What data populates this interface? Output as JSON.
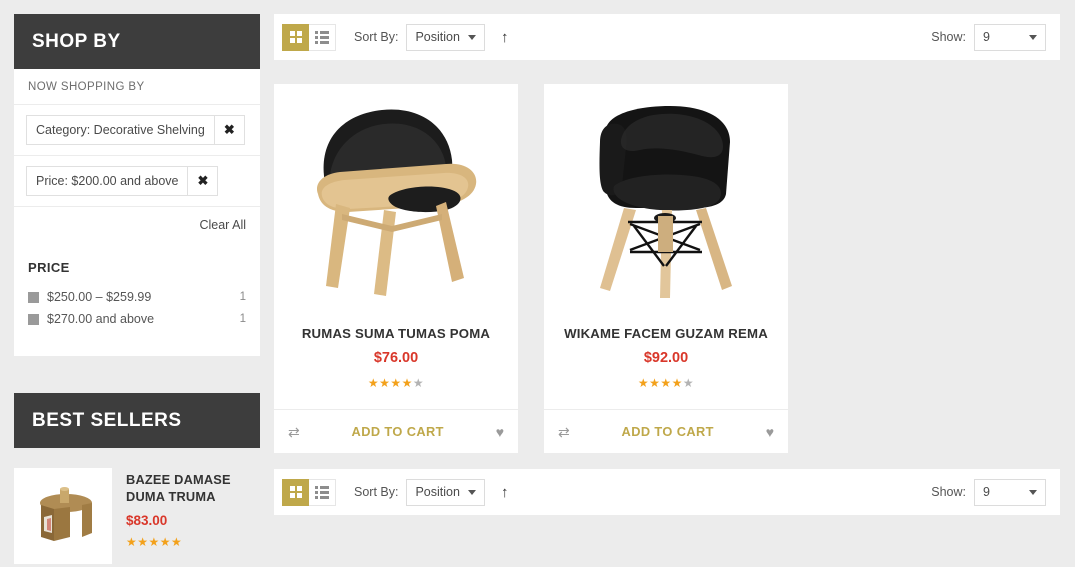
{
  "sidebar": {
    "shop_by_title": "SHOP BY",
    "now_shopping_by_label": "NOW SHOPPING BY",
    "active_filters": [
      {
        "label": "Category: Decorative Shelving",
        "remove_icon": "✖"
      },
      {
        "label": "Price: $200.00 and above",
        "remove_icon": "✖"
      }
    ],
    "clear_all_label": "Clear All",
    "price": {
      "title": "PRICE",
      "options": [
        {
          "label": "$250.00 – $259.99",
          "count": "1"
        },
        {
          "label": "$270.00 and above",
          "count": "1"
        }
      ]
    },
    "best_sellers": {
      "title": "BEST SELLERS",
      "items": [
        {
          "name": "BAZEE DAMASE DUMA TRUMA",
          "price": "$83.00",
          "rating": 5,
          "image_alt": "wooden-side-table-magazine-rack"
        }
      ]
    }
  },
  "toolbar": {
    "grid_view_icon": "grid-icon",
    "list_view_icon": "list-icon",
    "sort_by_label": "Sort By:",
    "sort_value": "Position",
    "sort_direction_icon": "↑",
    "show_label": "Show:",
    "show_value": "9"
  },
  "products": [
    {
      "name": "RUMAS SUMA TUMAS POMA",
      "price": "$76.00",
      "rating": 4,
      "add_to_cart_label": "ADD TO CART",
      "compare_icon": "⇄",
      "wishlist_icon": "♥",
      "image_alt": "wooden-shell-chair-black-leather"
    },
    {
      "name": "WIKAME FACEM GUZAM REMA",
      "price": "$92.00",
      "rating": 4,
      "add_to_cart_label": "ADD TO CART",
      "compare_icon": "⇄",
      "wishlist_icon": "♥",
      "image_alt": "black-eames-style-armchair-wooden-legs"
    }
  ],
  "colors": {
    "accent_gold": "#bfa84a",
    "price_red": "#d9372a",
    "header_dark": "#3d3d3d",
    "star_on": "#f3a11b",
    "star_off": "#b3b3b3",
    "page_bg": "#ececec"
  }
}
